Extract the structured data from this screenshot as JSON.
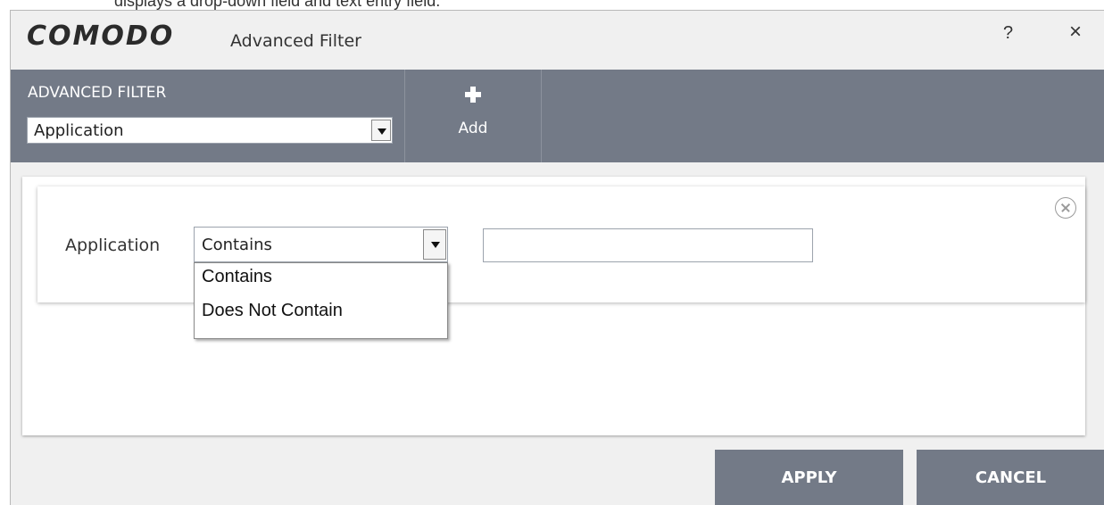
{
  "caption": "displays a drop-down field and text entry field.",
  "window": {
    "logo": "COMODO",
    "title": "Advanced Filter",
    "help_label": "?",
    "close_label": "×"
  },
  "toolbar": {
    "filter_heading": "ADVANCED FILTER",
    "filter_selected": "Application",
    "add_label": "Add"
  },
  "rule": {
    "label": "Application",
    "condition_selected": "Contains",
    "condition_options": [
      "Contains",
      "Does Not Contain"
    ],
    "value": ""
  },
  "footer": {
    "apply_label": "APPLY",
    "cancel_label": "CANCEL"
  },
  "colors": {
    "toolbar": "#737a87",
    "window_bg": "#f0f0f0",
    "button_bg": "#737a87"
  },
  "icons": [
    "plus-icon",
    "remove-circle-icon",
    "chevron-down-icon",
    "help-icon",
    "close-icon"
  ]
}
